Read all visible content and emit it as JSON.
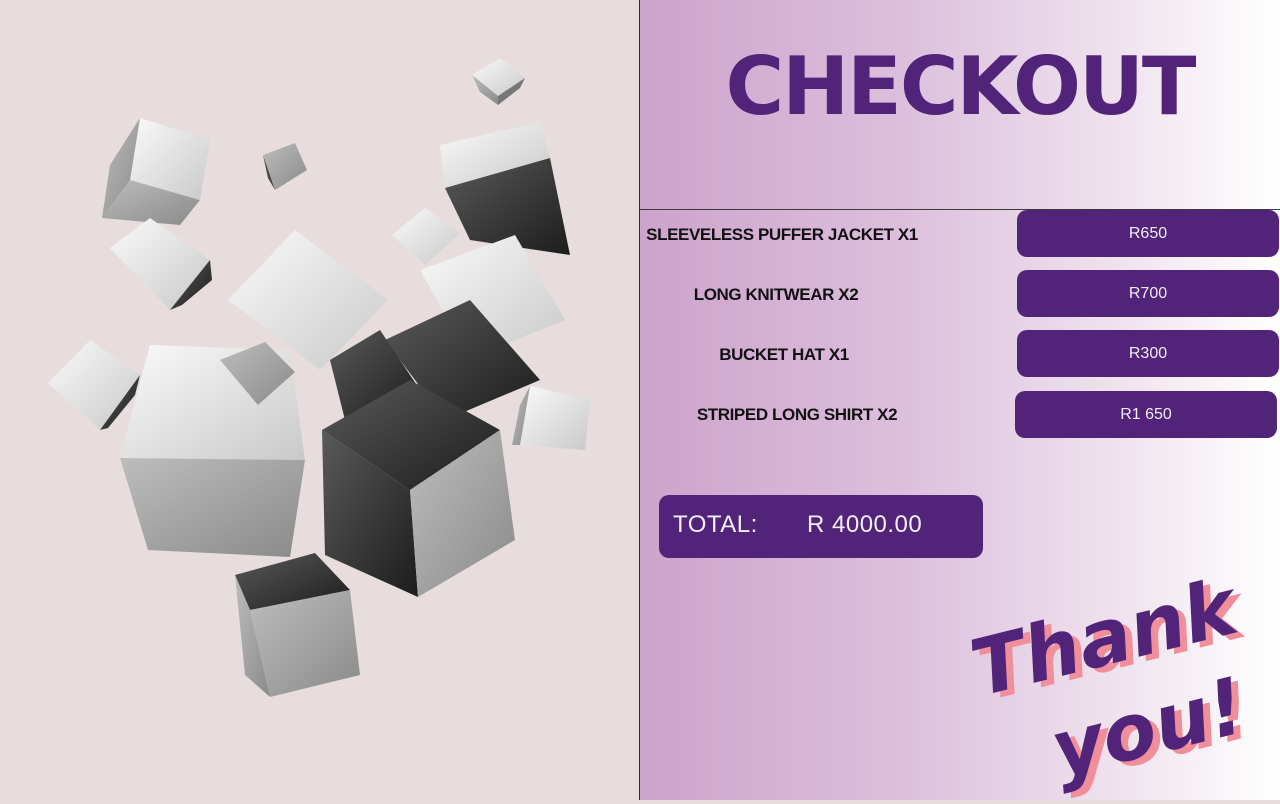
{
  "checkout": {
    "title": "CHECKOUT",
    "items": [
      {
        "label": "SLEEVELESS PUFFER JACKET  X1",
        "price": "R650"
      },
      {
        "label": "LONG KNITWEAR  X2",
        "price": "R700"
      },
      {
        "label": "BUCKET HAT  X1",
        "price": "R300"
      },
      {
        "label": "STRIPED LONG SHIRT  X2",
        "price": "R1 650"
      }
    ],
    "total_label": "TOTAL:",
    "total_value": "R  4000.00",
    "thanks_line1": "Thank",
    "thanks_line2": "you!"
  },
  "colors": {
    "accent": "#51247a",
    "left_background": "#e8dddd",
    "gradient_start": "#cda3cc",
    "thanks_shadow": "#f08f9a"
  },
  "decor": {
    "image": "floating-metal-cubes"
  }
}
